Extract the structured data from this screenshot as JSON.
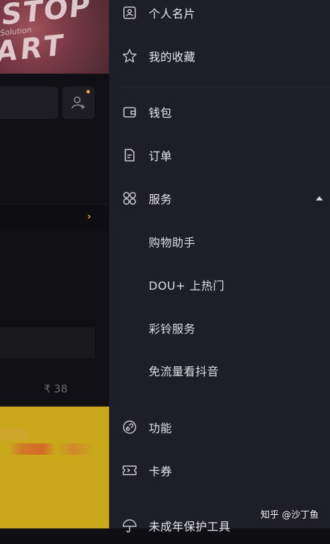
{
  "background": {
    "banner_text_top": "STOP",
    "banner_text_mid": "Solution",
    "banner_text_bottom": "ART",
    "price": "₹ 38"
  },
  "drawer": {
    "items": [
      {
        "label": "个人名片",
        "icon": "id-card-icon"
      },
      {
        "label": "我的收藏",
        "icon": "star-icon"
      },
      {
        "label": "钱包",
        "icon": "wallet-icon"
      },
      {
        "label": "订单",
        "icon": "order-document-icon"
      },
      {
        "label": "服务",
        "icon": "services-grid-icon",
        "expanded": true
      },
      {
        "label": "功能",
        "icon": "link-icon"
      },
      {
        "label": "卡券",
        "icon": "coupon-ticket-icon"
      },
      {
        "label": "未成年保护工具",
        "icon": "umbrella-icon"
      }
    ],
    "service_subitems": [
      {
        "label": "购物助手"
      },
      {
        "label": "DOU+ 上热门"
      },
      {
        "label": "彩铃服务"
      },
      {
        "label": "免流量看抖音"
      }
    ]
  },
  "watermark": "知乎 @沙丁鱼",
  "colors": {
    "drawer_bg": "#1e1e28",
    "text": "#e6e6ea",
    "icon": "#c8c8cc",
    "accent": "#e4a73e"
  }
}
